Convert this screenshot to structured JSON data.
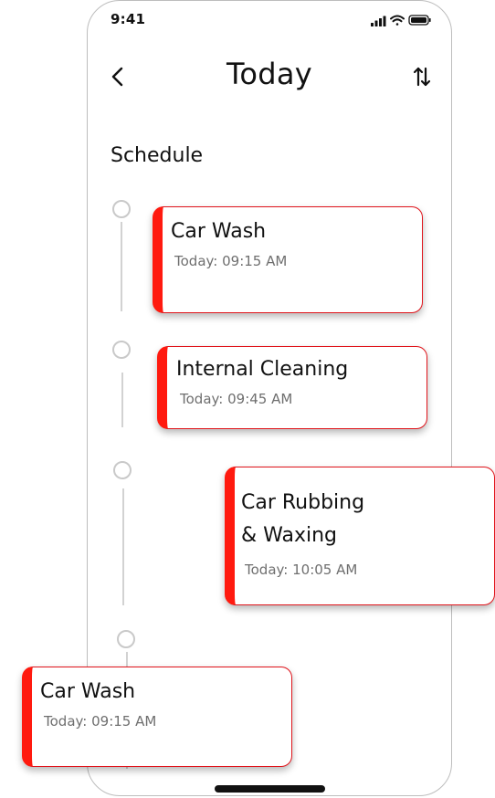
{
  "status_bar": {
    "time": "9:41",
    "icons": [
      "signal-icon",
      "wifi-icon",
      "battery-icon"
    ]
  },
  "header": {
    "title": "Today",
    "back_icon": "chevron-left-icon",
    "sort_icon": "sort-arrows-icon"
  },
  "schedule": {
    "title": "Schedule",
    "items": [
      {
        "title": "Car Wash",
        "time": "Today: 09:15 AM"
      },
      {
        "title": "Internal Cleaning",
        "time": "Today: 09:45 AM"
      },
      {
        "title": "Car Rubbing\n & Waxing",
        "time": "Today: 10:05 AM"
      },
      {
        "title": "Car Wash",
        "time": "Today: 09:15 AM"
      }
    ]
  },
  "colors": {
    "accent": "#ff1a0f",
    "card_border": "#e0141b",
    "timeline": "#d2d2d2",
    "muted_text": "#6f6f6f"
  }
}
